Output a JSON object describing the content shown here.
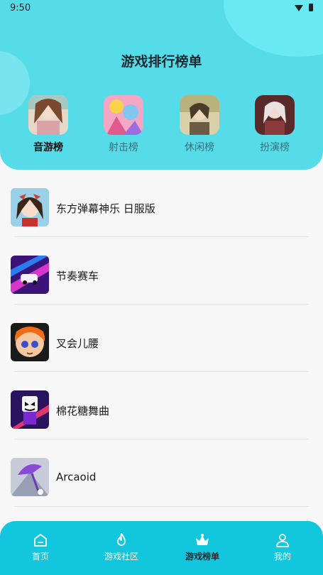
{
  "status_bar": {
    "time": "9:50"
  },
  "header": {
    "title": "游戏排行榜单"
  },
  "categories": [
    {
      "label": "音游榜",
      "active": true
    },
    {
      "label": "射击榜",
      "active": false
    },
    {
      "label": "休闲榜",
      "active": false
    },
    {
      "label": "扮演榜",
      "active": false
    }
  ],
  "games": [
    {
      "name": "东方弹幕神乐 日服版"
    },
    {
      "name": "节奏赛车"
    },
    {
      "name": "叉会儿腰"
    },
    {
      "name": "棉花糖舞曲"
    },
    {
      "name": "Arcaoid"
    }
  ],
  "tabbar": {
    "items": [
      {
        "label": "首页",
        "icon": "home-icon"
      },
      {
        "label": "游戏社区",
        "icon": "flame-icon"
      },
      {
        "label": "游戏榜单",
        "icon": "crown-icon",
        "active": true
      },
      {
        "label": "我的",
        "icon": "person-icon"
      }
    ]
  },
  "colors": {
    "header": "#56dbe8",
    "tabbar": "#12c6dd"
  }
}
